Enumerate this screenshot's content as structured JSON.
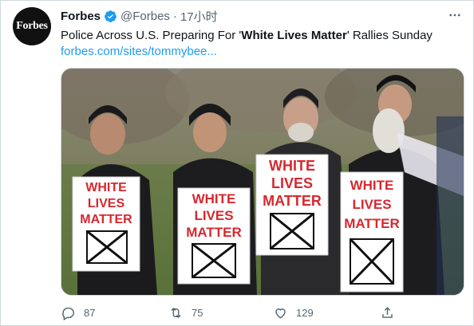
{
  "author": {
    "avatar_text": "Forbes",
    "display_name": "Forbes",
    "handle": "@Forbes",
    "separator": "·",
    "time": "17小时"
  },
  "tweet": {
    "text_before": "Police Across U.S. Preparing For '",
    "text_bold": "White Lives Matter",
    "text_after": "' Rallies Sunday",
    "link": "forbes.com/sites/tommybee..."
  },
  "media": {
    "sign_lines": [
      "WHITE",
      "LIVES",
      "MATTER"
    ]
  },
  "actions": {
    "reply_count": "87",
    "retweet_count": "75",
    "like_count": "129"
  },
  "colors": {
    "accent": "#1d9bf0",
    "muted": "#536471",
    "sign_red": "#d7282f"
  },
  "icons": {
    "more": "more-icon",
    "verified": "verified-badge-icon",
    "reply": "reply-icon",
    "retweet": "retweet-icon",
    "like": "heart-icon",
    "share": "share-icon"
  }
}
